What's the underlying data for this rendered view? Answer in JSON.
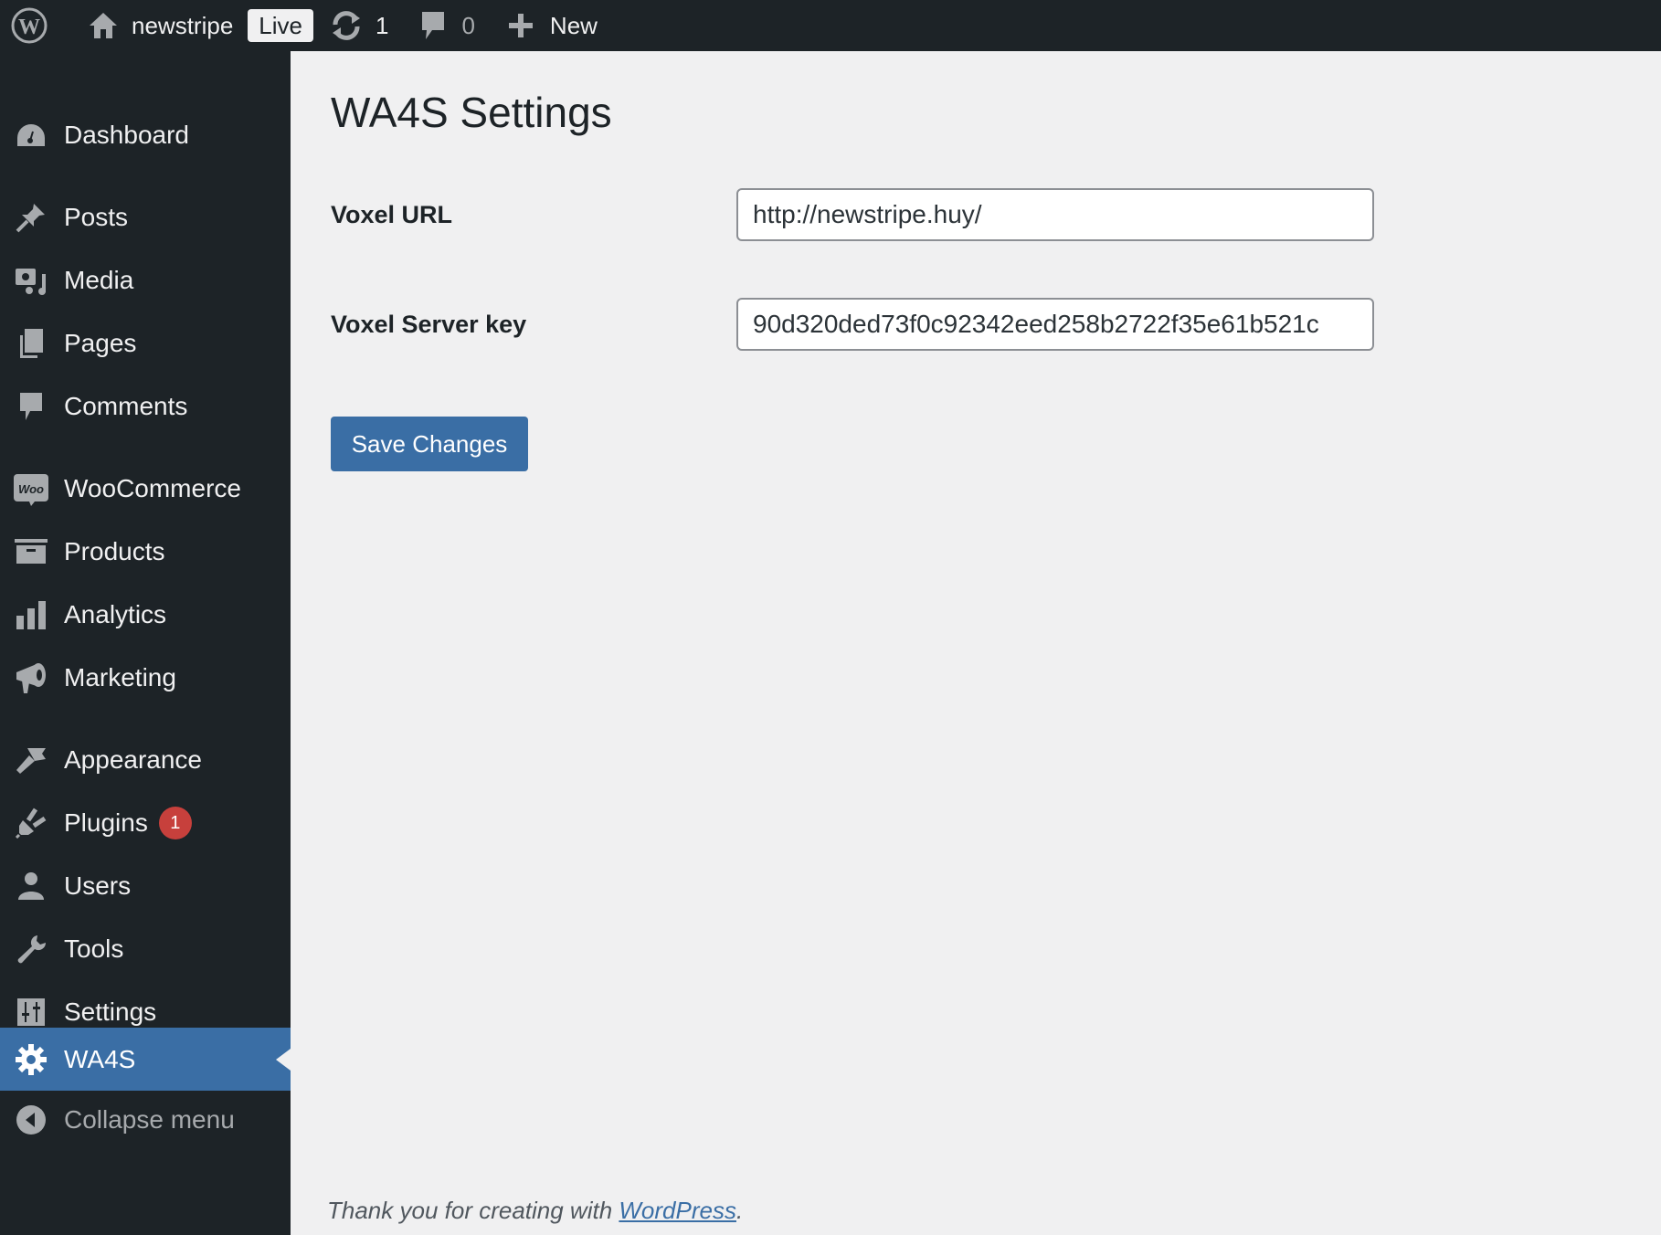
{
  "topbar": {
    "site_name": "newstripe",
    "live_badge": "Live",
    "updates_count": "1",
    "comments_count": "0",
    "new_label": "New",
    "icons": [
      "wordpress-logo-icon",
      "home-icon",
      "updates-icon",
      "comment-icon",
      "plus-icon"
    ]
  },
  "sidebar": {
    "items": [
      {
        "label": "Dashboard",
        "icon": "dashboard-icon"
      },
      {
        "label": "Posts",
        "icon": "pin-icon"
      },
      {
        "label": "Media",
        "icon": "media-icon"
      },
      {
        "label": "Pages",
        "icon": "pages-icon"
      },
      {
        "label": "Comments",
        "icon": "comment-icon"
      },
      {
        "label": "WooCommerce",
        "icon": "woo-icon",
        "icon_text": "Woo"
      },
      {
        "label": "Products",
        "icon": "archive-icon"
      },
      {
        "label": "Analytics",
        "icon": "bar-chart-icon"
      },
      {
        "label": "Marketing",
        "icon": "megaphone-icon"
      },
      {
        "label": "Appearance",
        "icon": "brush-icon"
      },
      {
        "label": "Plugins",
        "icon": "plug-icon",
        "badge": "1"
      },
      {
        "label": "Users",
        "icon": "user-icon"
      },
      {
        "label": "Tools",
        "icon": "wrench-icon"
      },
      {
        "label": "Settings",
        "icon": "sliders-icon"
      },
      {
        "label": "WA4S",
        "icon": "gear-icon",
        "active": true
      },
      {
        "label": "Collapse menu",
        "icon": "collapse-icon"
      }
    ]
  },
  "page": {
    "title": "WA4S Settings",
    "fields": [
      {
        "label": "Voxel URL",
        "value": "http://newstripe.huy/"
      },
      {
        "label": "Voxel Server key",
        "value": "90d320ded73f0c92342eed258b2722f35e61b521c"
      }
    ],
    "save_label": "Save Changes"
  },
  "footer": {
    "text": "Thank you for creating with ",
    "link_text": "WordPress",
    "period": "."
  },
  "colors": {
    "admin_bar": "#1d2327",
    "accent": "#3a6ea5",
    "badge": "#c7403c",
    "background": "#f0f0f1"
  }
}
